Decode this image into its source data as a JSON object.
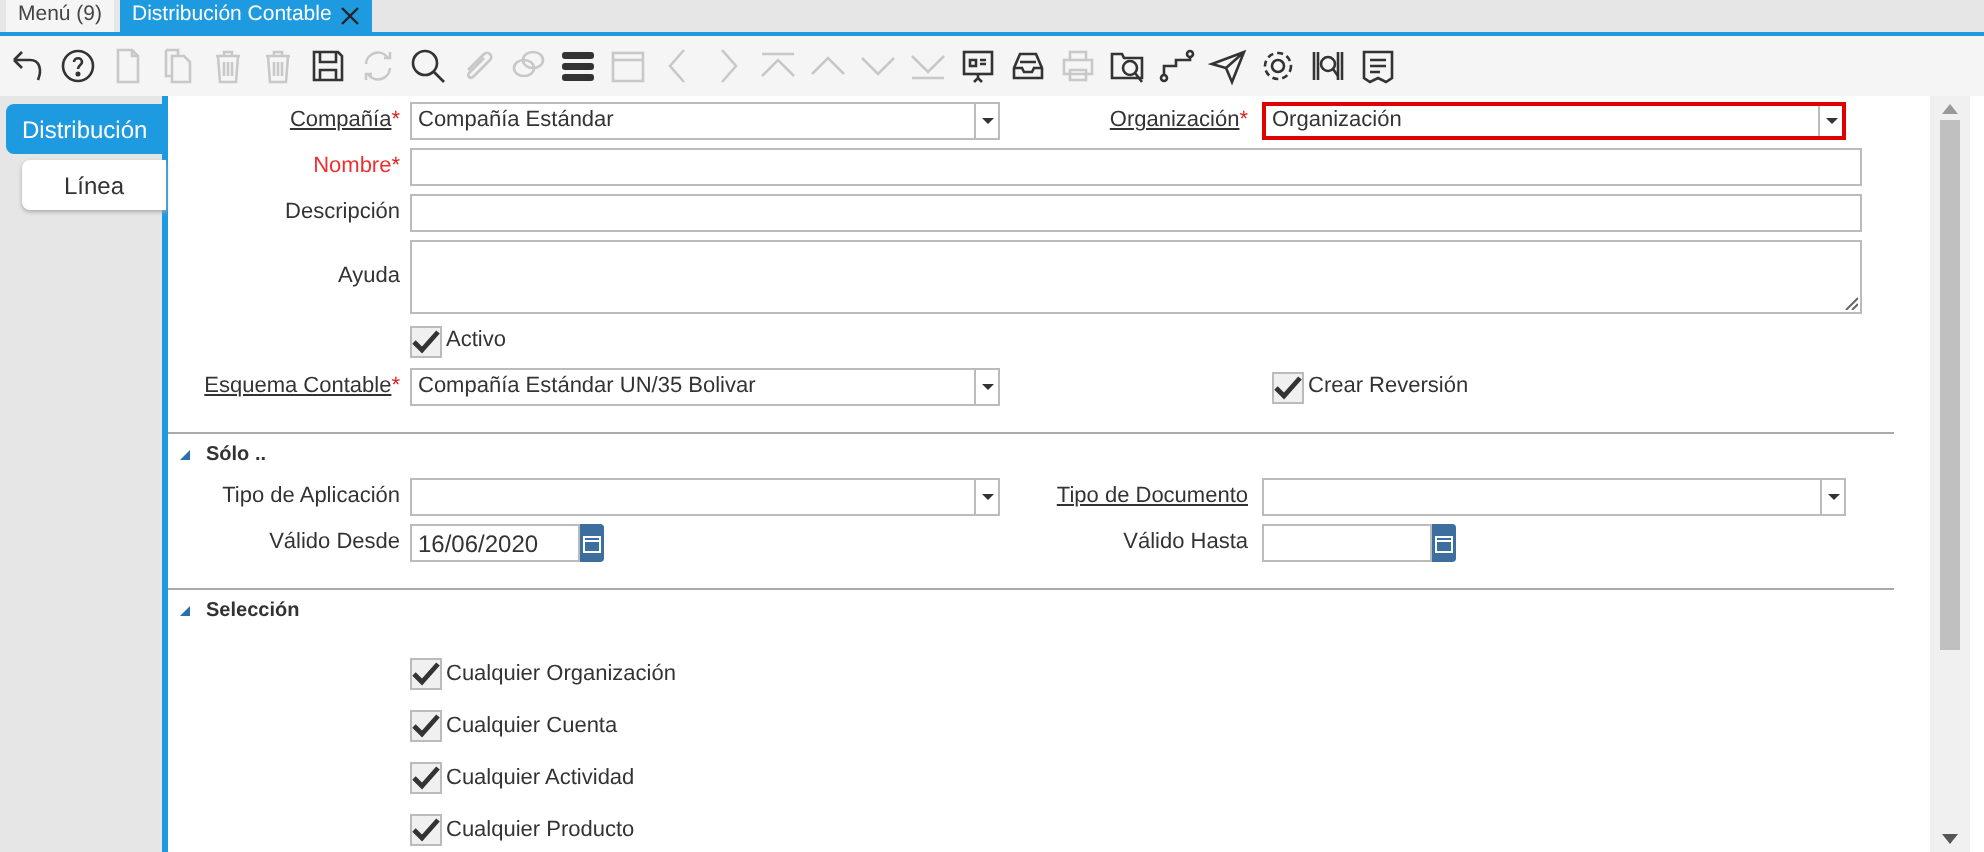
{
  "app_tabs": [
    {
      "label": "Menú (9)",
      "selected": false,
      "closable": false
    },
    {
      "label": "Distribución Contable",
      "selected": true,
      "closable": true
    }
  ],
  "toolbar": [
    {
      "kind": "undo",
      "disabled": false
    },
    {
      "kind": "help",
      "disabled": false
    },
    {
      "kind": "new",
      "disabled": true
    },
    {
      "kind": "copy",
      "disabled": true
    },
    {
      "kind": "delete",
      "disabled": true
    },
    {
      "kind": "delete",
      "disabled": true
    },
    {
      "kind": "save",
      "disabled": false
    },
    {
      "kind": "refresh",
      "disabled": true
    },
    {
      "kind": "search",
      "disabled": false
    },
    {
      "kind": "attach",
      "disabled": true
    },
    {
      "kind": "chat",
      "disabled": true
    },
    {
      "kind": "grid",
      "disabled": false
    },
    {
      "kind": "calendar",
      "disabled": true
    },
    {
      "kind": "previous",
      "disabled": true
    },
    {
      "kind": "next",
      "disabled": true
    },
    {
      "kind": "first",
      "disabled": true
    },
    {
      "kind": "up",
      "disabled": true
    },
    {
      "kind": "down",
      "disabled": true
    },
    {
      "kind": "last",
      "disabled": true
    },
    {
      "kind": "report",
      "disabled": false
    },
    {
      "kind": "archive",
      "disabled": false
    },
    {
      "kind": "print",
      "disabled": true
    },
    {
      "kind": "zoom",
      "disabled": false
    },
    {
      "kind": "workflow",
      "disabled": false
    },
    {
      "kind": "send",
      "disabled": false
    },
    {
      "kind": "settings",
      "disabled": false
    },
    {
      "kind": "product",
      "disabled": false
    },
    {
      "kind": "document",
      "disabled": false
    }
  ],
  "side_tabs": [
    {
      "label": "Distribución",
      "selected": true
    },
    {
      "label": "Línea",
      "selected": false
    }
  ],
  "rows": [
    [
      {
        "kind": "combo",
        "label": "Compañía",
        "link": true,
        "required_mark": "*",
        "value": "Compañía Estándar",
        "missing": false,
        "highlighted": false
      },
      {
        "kind": "combo",
        "label": "Organización",
        "link": true,
        "required_mark": "*",
        "value": "Organización",
        "missing": false,
        "highlighted": true
      }
    ],
    [
      {
        "kind": "text",
        "label": "Nombre",
        "link": false,
        "required_mark": "*",
        "missing": true,
        "highlighted": false
      }
    ],
    [
      {
        "kind": "text",
        "label": "Descripción",
        "link": false,
        "missing": false,
        "highlighted": false
      }
    ],
    [
      {
        "kind": "textarea",
        "label": "Ayuda",
        "link": false,
        "missing": false,
        "highlighted": false
      }
    ],
    [
      {
        "kind": "checkbox",
        "label": "Activo",
        "checked": true
      }
    ],
    [
      {
        "kind": "combo",
        "label": "Esquema Contable",
        "link": true,
        "required_mark": "*",
        "value": "Compañía Estándar UN/35 Bolivar",
        "missing": false,
        "highlighted": false
      },
      {
        "kind": "checkbox",
        "label": "Crear Reversión",
        "checked": true
      }
    ]
  ],
  "sections": [
    {
      "title": "Sólo ..",
      "expanded": true,
      "rows": [
        [
          {
            "kind": "combo",
            "label": "Tipo de Aplicación",
            "link": false,
            "missing": false,
            "highlighted": false
          },
          {
            "kind": "combo",
            "label": "Tipo de Documento",
            "link": true,
            "missing": false,
            "highlighted": false
          }
        ],
        [
          {
            "kind": "date",
            "label": "Válido Desde",
            "value": "16/06/2020",
            "missing": false,
            "highlighted": false
          },
          {
            "kind": "date",
            "label": "Válido Hasta",
            "missing": false,
            "highlighted": false
          }
        ]
      ]
    },
    {
      "title": "Selección",
      "expanded": true,
      "rows": [
        [
          {
            "kind": "checkbox",
            "label": "Cualquier Organización",
            "checked": true
          }
        ],
        [
          {
            "kind": "checkbox",
            "label": "Cualquier Cuenta",
            "checked": true
          }
        ],
        [
          {
            "kind": "checkbox",
            "label": "Cualquier Actividad",
            "checked": true
          }
        ],
        [
          {
            "kind": "checkbox",
            "label": "Cualquier Producto",
            "checked": true
          }
        ]
      ]
    }
  ]
}
